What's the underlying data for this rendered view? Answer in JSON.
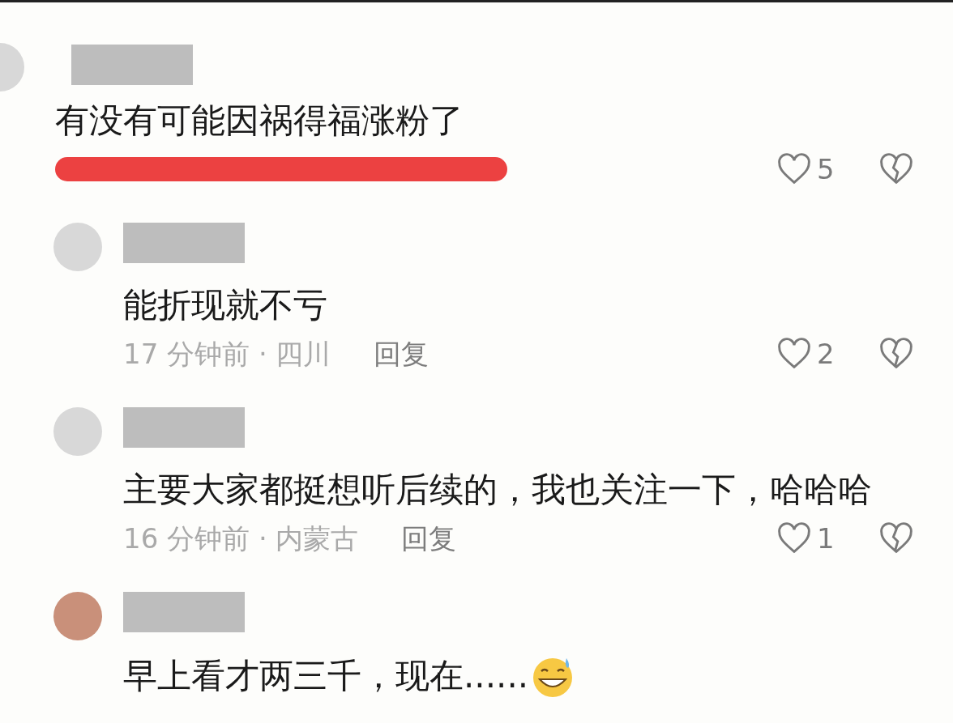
{
  "comments": [
    {
      "kind": "comment",
      "text": "有没有可能因祸得福涨粉了",
      "meta_redacted": true,
      "likes": "5"
    },
    {
      "kind": "reply",
      "text": "能折现就不亏",
      "meta": "17 分钟前 · 四川",
      "reply": "回复",
      "likes": "2"
    },
    {
      "kind": "reply",
      "text": "主要大家都挺想听后续的，我也关注一下，哈哈哈",
      "meta": "16 分钟前 · 内蒙古",
      "reply": "回复",
      "likes": "1"
    },
    {
      "kind": "reply",
      "text": "早上看才两三千，现在......",
      "trailing_emoji": true
    }
  ]
}
